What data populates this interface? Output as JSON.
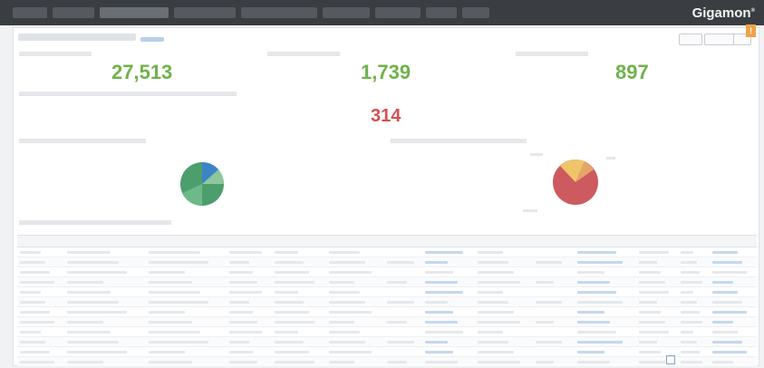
{
  "brand": "Gigamon",
  "kpis": [
    {
      "value": "27,513"
    },
    {
      "value": "1,739"
    },
    {
      "value": "897"
    }
  ],
  "highlight": {
    "value": "314"
  },
  "colors": {
    "kpi_green": "#6fb24a",
    "kpi_red": "#d64f4f",
    "pie1": [
      "#4d9e6d",
      "#8dc79e",
      "#3d84c6"
    ],
    "pie2": [
      "#cd5a5f",
      "#f0c56a",
      "#e6a46a"
    ]
  },
  "icons": {
    "edit": "pencil-icon",
    "export": "download-icon",
    "settings": "gear-icon"
  }
}
